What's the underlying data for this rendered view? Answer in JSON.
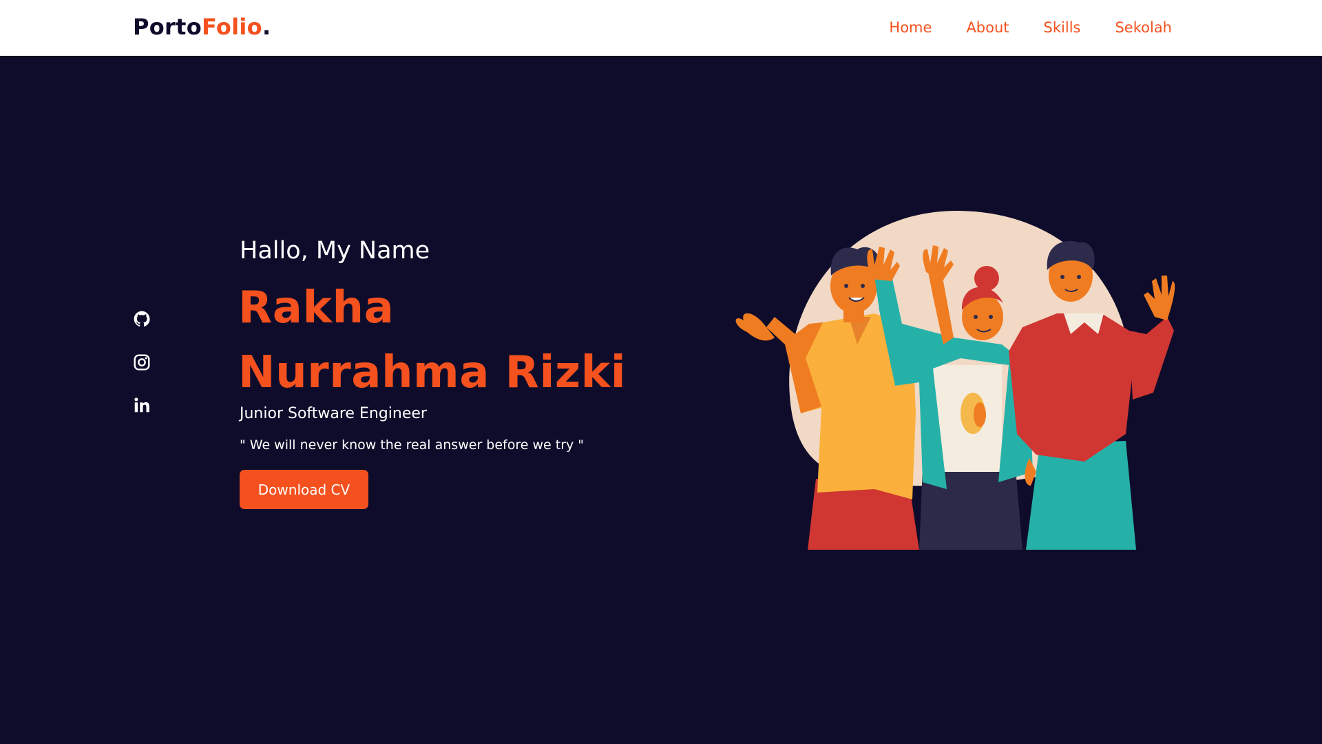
{
  "header": {
    "logo_main": "Porto",
    "logo_accent": "Folio",
    "logo_dot": ".",
    "nav": [
      {
        "label": "Home"
      },
      {
        "label": "About"
      },
      {
        "label": "Skills"
      },
      {
        "label": "Sekolah"
      }
    ]
  },
  "social": [
    {
      "icon": "github-icon"
    },
    {
      "icon": "instagram-icon"
    },
    {
      "icon": "linkedin-icon"
    }
  ],
  "hero": {
    "greeting": "Hallo, My Name",
    "name": "Rakha Nurrahma Rizki",
    "role": "Junior Software Engineer",
    "quote": "\" We will never know the real answer before we try \"",
    "cta_label": "Download CV",
    "illustration": "three-people-waving-illustration"
  },
  "colors": {
    "background": "#0e0c2a",
    "accent": "#f4511e",
    "header_bg": "#ffffff",
    "text": "#ffffff"
  }
}
